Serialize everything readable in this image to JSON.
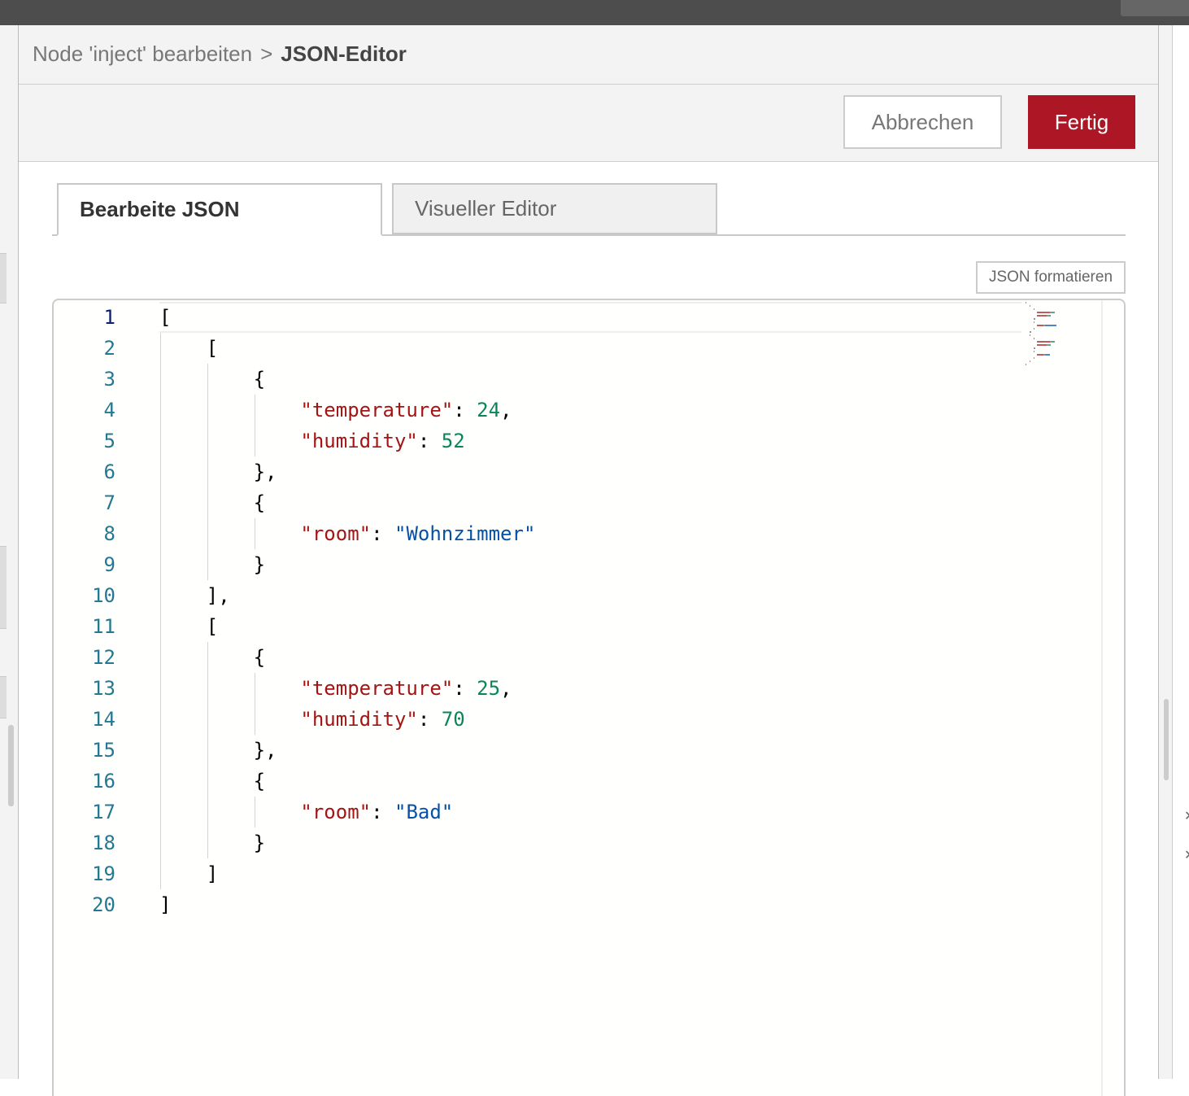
{
  "breadcrumb": {
    "parent": "Node 'inject' bearbeiten",
    "separator": ">",
    "current": "JSON-Editor"
  },
  "toolbar": {
    "cancel_label": "Abbrechen",
    "done_label": "Fertig"
  },
  "tabs": [
    {
      "label": "Bearbeite JSON",
      "active": true
    },
    {
      "label": "Visueller Editor",
      "active": false
    }
  ],
  "format_button_label": "JSON formatieren",
  "editor": {
    "line_numbers": [
      "1",
      "2",
      "3",
      "4",
      "5",
      "6",
      "7",
      "8",
      "9",
      "10",
      "11",
      "12",
      "13",
      "14",
      "15",
      "16",
      "17",
      "18",
      "19",
      "20"
    ],
    "lines": [
      [
        {
          "t": "p",
          "v": "["
        }
      ],
      [
        {
          "t": "p",
          "v": "    ["
        }
      ],
      [
        {
          "t": "p",
          "v": "        {"
        }
      ],
      [
        {
          "t": "p",
          "v": "            "
        },
        {
          "t": "k",
          "v": "\"temperature\""
        },
        {
          "t": "p",
          "v": ": "
        },
        {
          "t": "n",
          "v": "24"
        },
        {
          "t": "p",
          "v": ","
        }
      ],
      [
        {
          "t": "p",
          "v": "            "
        },
        {
          "t": "k",
          "v": "\"humidity\""
        },
        {
          "t": "p",
          "v": ": "
        },
        {
          "t": "n",
          "v": "52"
        }
      ],
      [
        {
          "t": "p",
          "v": "        },"
        }
      ],
      [
        {
          "t": "p",
          "v": "        {"
        }
      ],
      [
        {
          "t": "p",
          "v": "            "
        },
        {
          "t": "k",
          "v": "\"room\""
        },
        {
          "t": "p",
          "v": ": "
        },
        {
          "t": "s",
          "v": "\"Wohnzimmer\""
        }
      ],
      [
        {
          "t": "p",
          "v": "        }"
        }
      ],
      [
        {
          "t": "p",
          "v": "    ],"
        }
      ],
      [
        {
          "t": "p",
          "v": "    ["
        }
      ],
      [
        {
          "t": "p",
          "v": "        {"
        }
      ],
      [
        {
          "t": "p",
          "v": "            "
        },
        {
          "t": "k",
          "v": "\"temperature\""
        },
        {
          "t": "p",
          "v": ": "
        },
        {
          "t": "n",
          "v": "25"
        },
        {
          "t": "p",
          "v": ","
        }
      ],
      [
        {
          "t": "p",
          "v": "            "
        },
        {
          "t": "k",
          "v": "\"humidity\""
        },
        {
          "t": "p",
          "v": ": "
        },
        {
          "t": "n",
          "v": "70"
        }
      ],
      [
        {
          "t": "p",
          "v": "        },"
        }
      ],
      [
        {
          "t": "p",
          "v": "        {"
        }
      ],
      [
        {
          "t": "p",
          "v": "            "
        },
        {
          "t": "k",
          "v": "\"room\""
        },
        {
          "t": "p",
          "v": ": "
        },
        {
          "t": "s",
          "v": "\"Bad\""
        }
      ],
      [
        {
          "t": "p",
          "v": "        }"
        }
      ],
      [
        {
          "t": "p",
          "v": "    ]"
        }
      ],
      [
        {
          "t": "p",
          "v": "]"
        }
      ]
    ],
    "active_line": 1
  },
  "colors": {
    "accent": "#ad1625",
    "json_key": "#a31515",
    "json_number": "#098658",
    "json_string": "#0451a5",
    "line_number": "#237893"
  },
  "right_panel_icons": [
    "close-icon",
    "close-icon"
  ]
}
